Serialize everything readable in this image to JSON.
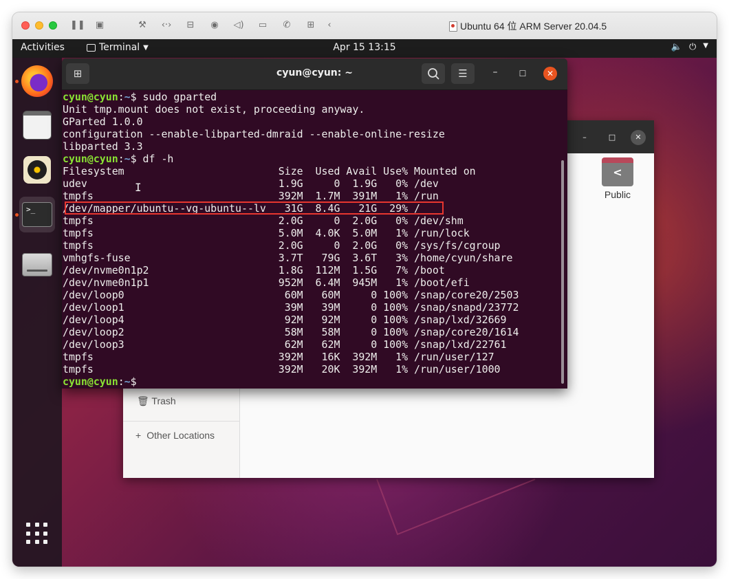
{
  "host": {
    "title": "Ubuntu 64 位 ARM Server 20.04.5",
    "toolbar_icons": [
      "pause-icon",
      "snapshot-icon",
      "wrench-icon",
      "network-icon",
      "disk-icon",
      "camera-icon",
      "volume-icon",
      "video-icon",
      "phone-icon",
      "folder-share-icon",
      "back-chevron-icon"
    ]
  },
  "ubuntu": {
    "topbar": {
      "activities": "Activities",
      "app_menu": "Terminal",
      "clock": "Apr 15  13:15",
      "tray_icons": [
        "volume-icon",
        "power-icon",
        "chevron-down-icon"
      ]
    },
    "dock": {
      "items": [
        "firefox",
        "files",
        "rhythmbox",
        "terminal",
        "drive"
      ],
      "running": [
        "firefox",
        "terminal"
      ]
    },
    "files": {
      "sidebar_trash": "Trash",
      "sidebar_other": "Other Locations",
      "folders": [
        {
          "label": "Public"
        }
      ]
    },
    "terminal": {
      "title": "cyun@cyun: ~",
      "lines": [
        {
          "type": "prompt",
          "user": "cyun@cyun",
          "path": "~",
          "cmd": " sudo gparted"
        },
        {
          "type": "out",
          "text": "Unit tmp.mount does not exist, proceeding anyway."
        },
        {
          "type": "out",
          "text": "GParted 1.0.0"
        },
        {
          "type": "out",
          "text": "configuration --enable-libparted-dmraid --enable-online-resize"
        },
        {
          "type": "out",
          "text": "libparted 3.3"
        },
        {
          "type": "prompt",
          "user": "cyun@cyun",
          "path": "~",
          "cmd": " df -h"
        },
        {
          "type": "out",
          "text": "Filesystem                         Size  Used Avail Use% Mounted on"
        },
        {
          "type": "out",
          "text": "udev                               1.9G     0  1.9G   0% /dev"
        },
        {
          "type": "out",
          "text": "tmpfs                              392M  1.7M  391M   1% /run"
        },
        {
          "type": "out",
          "text": "/dev/mapper/ubuntu--vg-ubuntu--lv   31G  8.4G   21G  29% /",
          "highlight": true
        },
        {
          "type": "out",
          "text": "tmpfs                              2.0G     0  2.0G   0% /dev/shm"
        },
        {
          "type": "out",
          "text": "tmpfs                              5.0M  4.0K  5.0M   1% /run/lock"
        },
        {
          "type": "out",
          "text": "tmpfs                              2.0G     0  2.0G   0% /sys/fs/cgroup"
        },
        {
          "type": "out",
          "text": "vmhgfs-fuse                        3.7T   79G  3.6T   3% /home/cyun/share"
        },
        {
          "type": "out",
          "text": "/dev/nvme0n1p2                     1.8G  112M  1.5G   7% /boot"
        },
        {
          "type": "out",
          "text": "/dev/nvme0n1p1                     952M  6.4M  945M   1% /boot/efi"
        },
        {
          "type": "out",
          "text": "/dev/loop0                          60M   60M     0 100% /snap/core20/2503"
        },
        {
          "type": "out",
          "text": "/dev/loop1                          39M   39M     0 100% /snap/snapd/23772"
        },
        {
          "type": "out",
          "text": "/dev/loop4                          92M   92M     0 100% /snap/lxd/32669"
        },
        {
          "type": "out",
          "text": "/dev/loop2                          58M   58M     0 100% /snap/core20/1614"
        },
        {
          "type": "out",
          "text": "/dev/loop3                          62M   62M     0 100% /snap/lxd/22761"
        },
        {
          "type": "out",
          "text": "tmpfs                              392M   16K  392M   1% /run/user/127"
        },
        {
          "type": "out",
          "text": "tmpfs                              392M   20K  392M   1% /run/user/1000"
        },
        {
          "type": "prompt",
          "user": "cyun@cyun",
          "path": "~",
          "cmd": ""
        }
      ]
    }
  },
  "colors": {
    "terminal_bg": "#300a24",
    "prompt_user": "#8ae234",
    "prompt_path": "#729fcf",
    "highlight_box": "#e8362f",
    "ubuntu_orange": "#e95420"
  }
}
